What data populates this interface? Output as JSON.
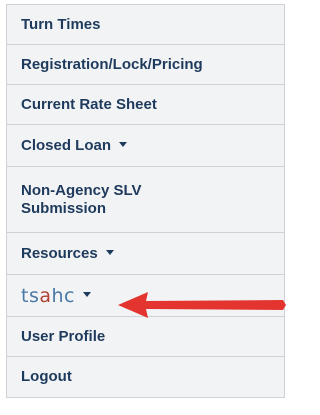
{
  "menu": {
    "items": [
      {
        "label": "Turn Times",
        "dropdown": false
      },
      {
        "label": "Registration/Lock/Pricing",
        "dropdown": false
      },
      {
        "label": "Current Rate Sheet",
        "dropdown": false
      },
      {
        "label": "Closed Loan",
        "dropdown": true
      },
      {
        "label": "Non-Agency SLV Submission",
        "dropdown": false
      },
      {
        "label": "Resources",
        "dropdown": true
      },
      {
        "label": "tsahc",
        "dropdown": true
      },
      {
        "label": "User Profile",
        "dropdown": false
      },
      {
        "label": "Logout",
        "dropdown": false
      }
    ],
    "logo_parts": {
      "pre": "ts",
      "mid": "a",
      "post": "hc"
    }
  },
  "colors": {
    "menu_text": "#1e3a5c",
    "menu_bg": "#f2f3f5",
    "border": "#cfd3d8",
    "arrow": "#e3342f",
    "logo_blue": "#4a78a6",
    "logo_accent": "#b04232"
  },
  "icons": {
    "dropdown": "caret-down-icon",
    "annotation": "red-arrow-left-icon"
  }
}
